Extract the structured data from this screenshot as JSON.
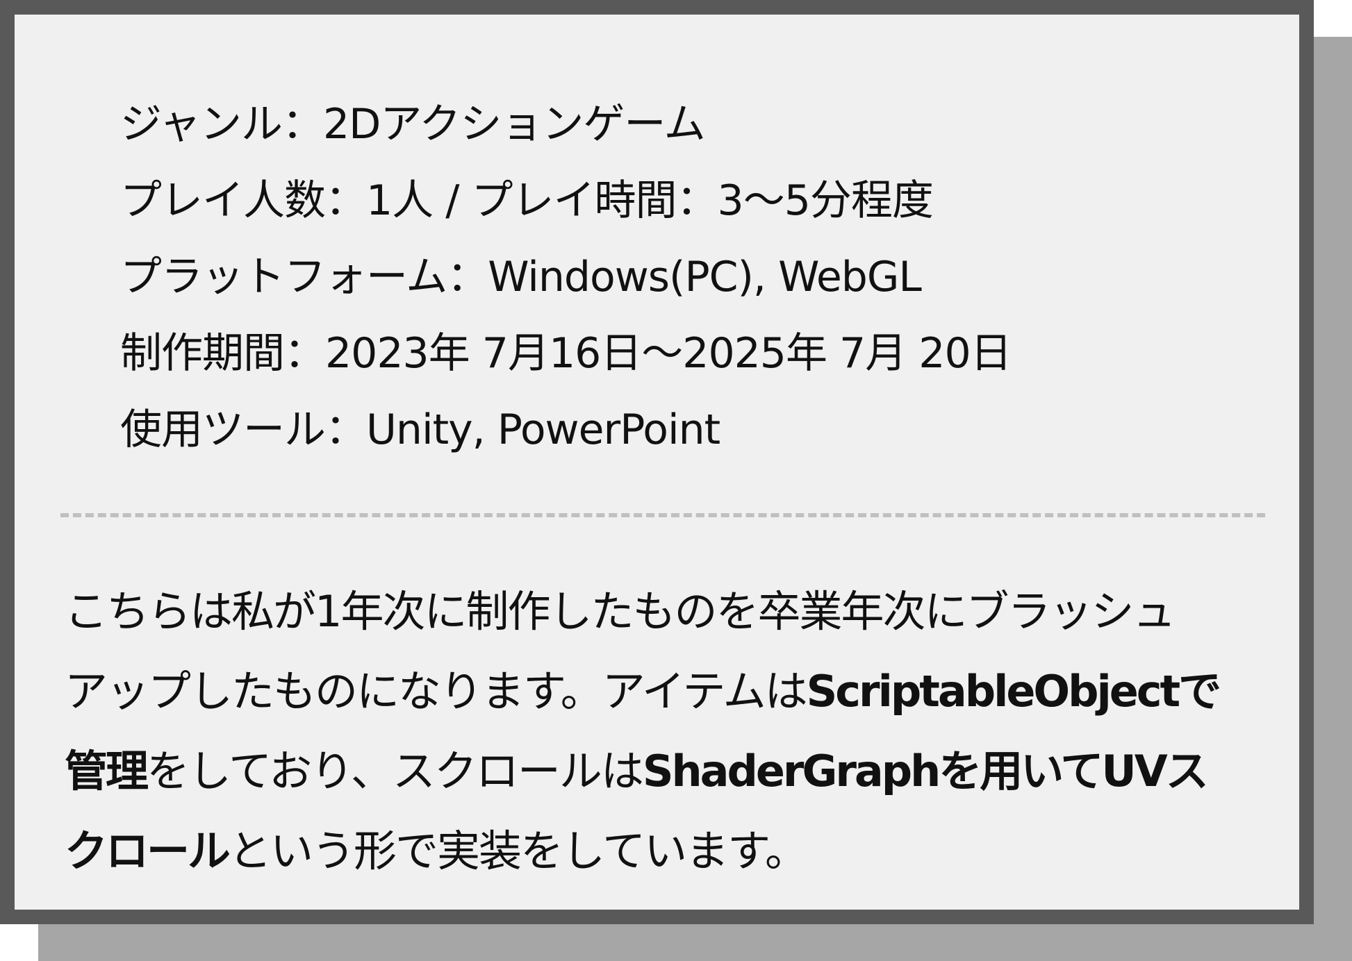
{
  "info": {
    "genre": "ジャンル：2Dアクションゲーム",
    "players": "プレイ人数：1人 / プレイ時間：3～5分程度",
    "platform": "プラットフォーム：Windows(PC), WebGL",
    "period": "制作期間：2023年 7月16日～2025年 7月 20日",
    "tools": "使用ツール：Unity, PowerPoint"
  },
  "description": {
    "line1": "こちらは私が1年次に制作したものを卒業年次にブラッシュ",
    "line2_plain": "アップしたものになります。アイテムは",
    "line2_bold": "ScriptableObjectで",
    "line3_bold1": "管理",
    "line3_plain": "をしており、スクロールは",
    "line3_bold2": "ShaderGraphを用いてUVス",
    "line4_bold": "クロール",
    "line4_plain": "という形で実装をしています。"
  },
  "colors": {
    "card_background": "#f0f0f0",
    "card_border": "#595959",
    "shadow": "#a6a6a6",
    "divider": "#c0c0c0",
    "text": "#111111"
  }
}
